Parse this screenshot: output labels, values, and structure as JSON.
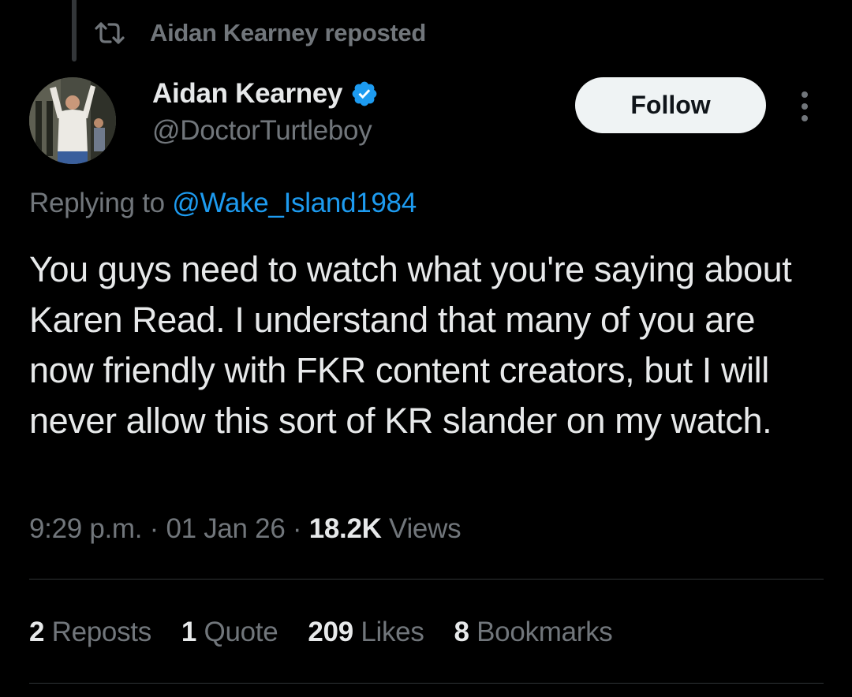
{
  "repost_header": {
    "text": "Aidan Kearney reposted",
    "icon": "repost-icon"
  },
  "author": {
    "display_name": "Aidan Kearney",
    "handle": "@DoctorTurtleboy",
    "verified": true,
    "verified_icon": "verified-badge-icon",
    "avatar": "profile-photo"
  },
  "actions": {
    "follow_label": "Follow",
    "more_icon": "more-options-icon"
  },
  "reply_context": {
    "prefix": "Replying to ",
    "mention": "@Wake_Island1984"
  },
  "tweet": {
    "text": "You guys need to watch what you're saying about Karen Read. I understand that many of you are now friendly with FKR content creators, but I will never allow this sort of KR slander on my watch."
  },
  "meta": {
    "time": "9:29 p.m.",
    "sep1": " · ",
    "date": "01 Jan 26",
    "sep2": " · ",
    "views_count": "18.2K",
    "views_label": " Views"
  },
  "stats": [
    {
      "count": "2",
      "label": "Reposts"
    },
    {
      "count": "1",
      "label": "Quote"
    },
    {
      "count": "209",
      "label": "Likes"
    },
    {
      "count": "8",
      "label": "Bookmarks"
    }
  ],
  "colors": {
    "background": "#000000",
    "text_primary": "#e7e9ea",
    "text_secondary": "#71767b",
    "accent_blue": "#1d9bf0",
    "divider": "#2f3336",
    "follow_bg": "#eff3f4"
  }
}
